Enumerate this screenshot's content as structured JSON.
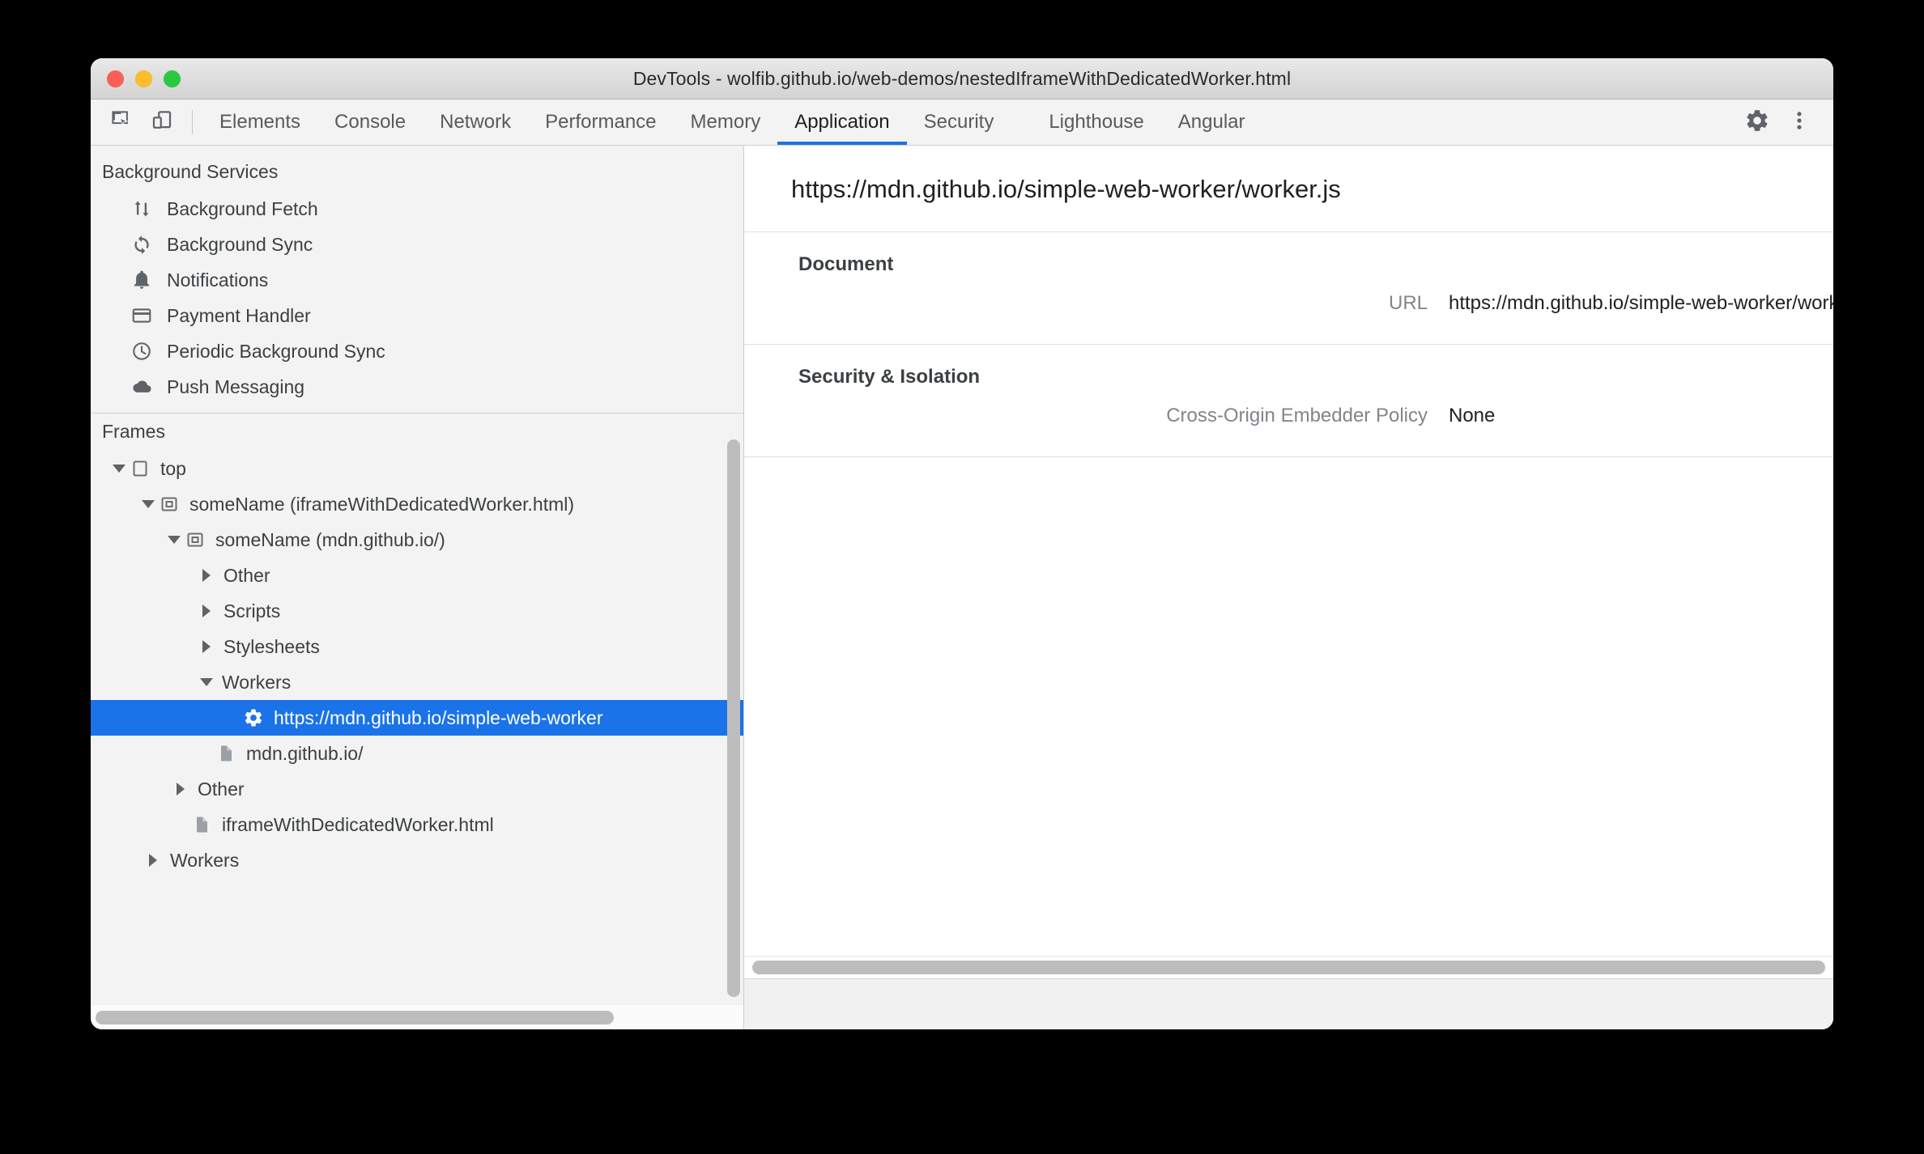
{
  "window": {
    "title": "DevTools - wolfib.github.io/web-demos/nestedIframeWithDedicatedWorker.html",
    "traffic_lights": [
      "close",
      "minimize",
      "zoom"
    ],
    "accent_color": "#1a73e8"
  },
  "toolbar": {
    "inspect_icon": "inspect-element-icon",
    "device_icon": "device-toolbar-icon",
    "settings_icon": "gear-icon",
    "more_icon": "more-vertical-icon",
    "tabs": [
      {
        "label": "Elements",
        "active": false
      },
      {
        "label": "Console",
        "active": false
      },
      {
        "label": "Network",
        "active": false
      },
      {
        "label": "Performance",
        "active": false
      },
      {
        "label": "Memory",
        "active": false
      },
      {
        "label": "Application",
        "active": true
      },
      {
        "label": "Security",
        "active": false
      },
      {
        "label": "Lighthouse",
        "active": false
      },
      {
        "label": "Angular",
        "active": false
      }
    ]
  },
  "sidebar": {
    "background_services": {
      "header": "Background Services",
      "items": [
        {
          "label": "Background Fetch",
          "icon": "background-fetch-icon"
        },
        {
          "label": "Background Sync",
          "icon": "background-sync-icon"
        },
        {
          "label": "Notifications",
          "icon": "bell-icon"
        },
        {
          "label": "Payment Handler",
          "icon": "credit-card-icon"
        },
        {
          "label": "Periodic Background Sync",
          "icon": "clock-icon"
        },
        {
          "label": "Push Messaging",
          "icon": "cloud-icon"
        }
      ]
    },
    "frames": {
      "header": "Frames",
      "tree": [
        {
          "label": "top",
          "icon": "frame-icon",
          "twisty": "open",
          "depth": 0,
          "selected": false
        },
        {
          "label": "someName (iframeWithDedicatedWorker.html)",
          "icon": "iframe-icon",
          "twisty": "open",
          "depth": 1,
          "selected": false
        },
        {
          "label": "someName (mdn.github.io/)",
          "icon": "iframe-icon",
          "twisty": "open",
          "depth": 2,
          "selected": false
        },
        {
          "label": "Other",
          "icon": "none",
          "twisty": "closed",
          "depth": 3,
          "selected": false
        },
        {
          "label": "Scripts",
          "icon": "none",
          "twisty": "closed",
          "depth": 3,
          "selected": false
        },
        {
          "label": "Stylesheets",
          "icon": "none",
          "twisty": "closed",
          "depth": 3,
          "selected": false
        },
        {
          "label": "Workers",
          "icon": "none",
          "twisty": "open",
          "depth": 3,
          "selected": false
        },
        {
          "label": "https://mdn.github.io/simple-web-worker",
          "icon": "gear-icon",
          "twisty": "none",
          "depth": 4,
          "selected": true
        },
        {
          "label": "mdn.github.io/",
          "icon": "document-icon",
          "twisty": "none",
          "depth": 3,
          "selected": false
        },
        {
          "label": "Other",
          "icon": "none",
          "twisty": "closed",
          "depth": 2,
          "selected": false
        },
        {
          "label": "iframeWithDedicatedWorker.html",
          "icon": "document-icon",
          "twisty": "none",
          "depth": 2,
          "selected": false
        },
        {
          "label": "Workers",
          "icon": "none",
          "twisty": "closed",
          "depth": 1,
          "selected": false
        }
      ]
    }
  },
  "main": {
    "report_title": "https://mdn.github.io/simple-web-worker/worker.js",
    "sections": [
      {
        "title": "Document",
        "rows": [
          {
            "key": "URL",
            "value": "https://mdn.github.io/simple-web-worker/worker.js"
          }
        ]
      },
      {
        "title": "Security & Isolation",
        "rows": [
          {
            "key": "Cross-Origin Embedder Policy",
            "value": "None"
          }
        ]
      }
    ]
  }
}
